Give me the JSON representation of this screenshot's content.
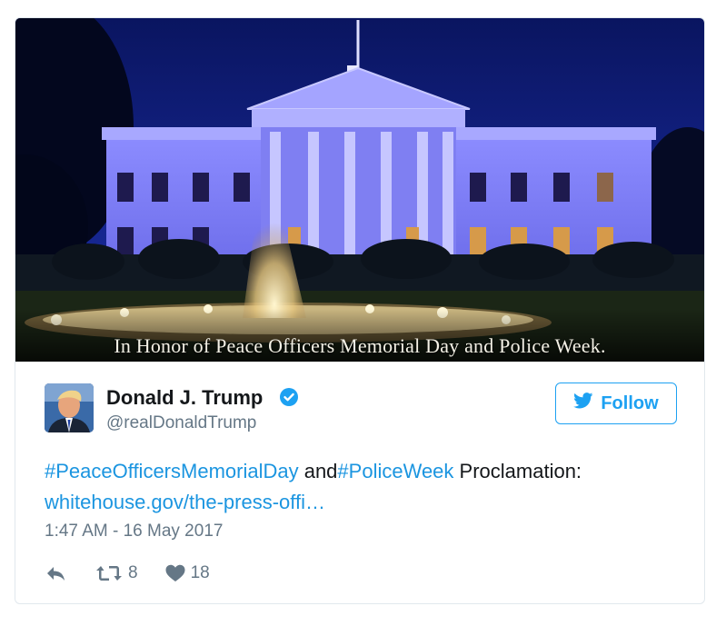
{
  "media": {
    "caption": "In Honor of Peace Officers Memorial Day and Police Week."
  },
  "author": {
    "name": "Donald J. Trump",
    "handle": "@realDonaldTrump",
    "verified": true
  },
  "follow_button": {
    "label": "Follow",
    "icon": "bird-icon"
  },
  "tweet": {
    "hashtag1": "#PeaceOfficersMemorialDay",
    "connector": " and",
    "hashtag2": "#PoliceWeek",
    "tail": " Proclamation:",
    "link": "whitehouse.gov/the-press-offi…",
    "timestamp": "1:47 AM - 16 May 2017"
  },
  "actions": {
    "retweet_count": "8",
    "like_count": "18"
  },
  "colors": {
    "accent": "#1da1f2",
    "link": "#1b95e0",
    "muted": "#657786",
    "text": "#14171a",
    "border": "#e1e8ed"
  }
}
